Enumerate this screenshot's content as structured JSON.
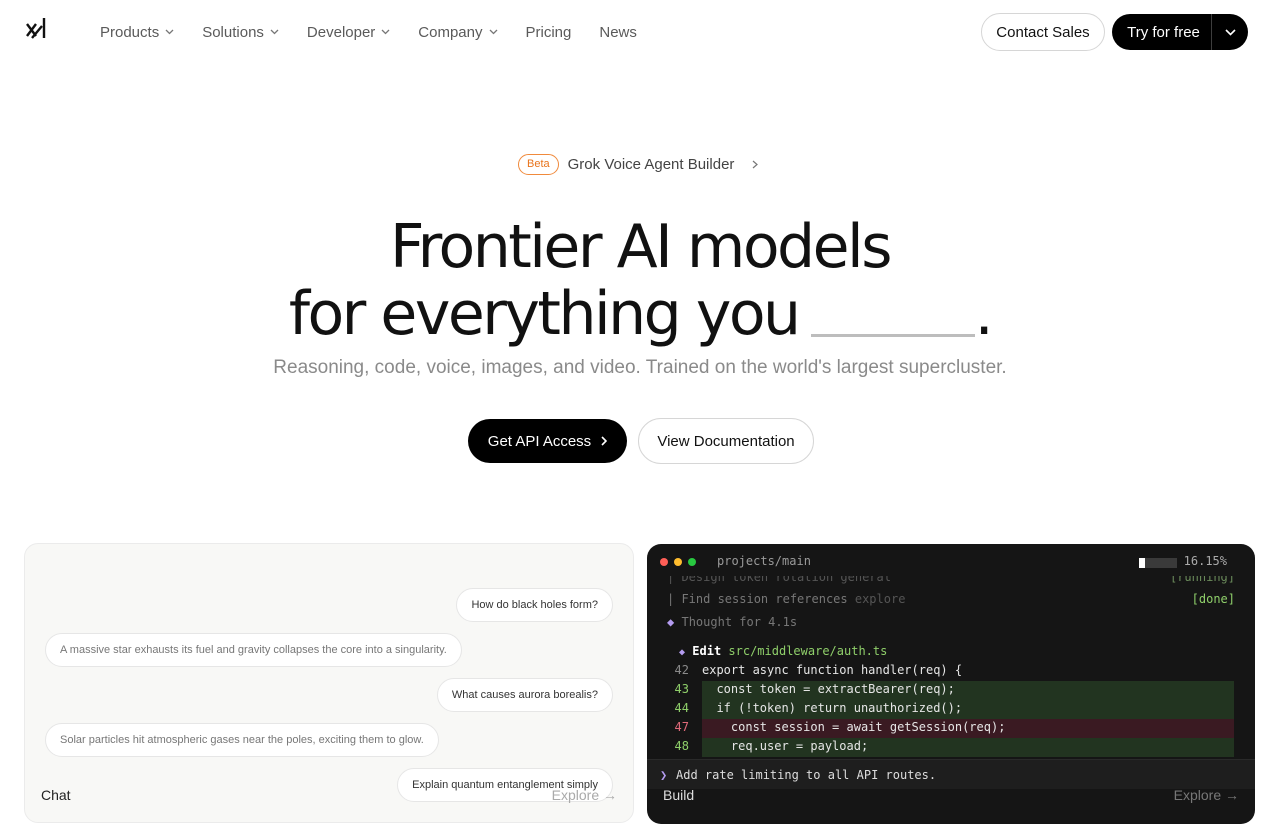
{
  "nav": {
    "logo_alt": "xAI",
    "items": [
      {
        "label": "Products",
        "has_dropdown": true
      },
      {
        "label": "Solutions",
        "has_dropdown": true
      },
      {
        "label": "Developer",
        "has_dropdown": true
      },
      {
        "label": "Company",
        "has_dropdown": true
      },
      {
        "label": "Pricing",
        "has_dropdown": false
      },
      {
        "label": "News",
        "has_dropdown": false
      }
    ],
    "contact_label": "Contact Sales",
    "try_label": "Try for free"
  },
  "announcement": {
    "badge": "Beta",
    "text": "Grok Voice Agent Builder"
  },
  "hero": {
    "line1": "Frontier AI models",
    "line2": "for everything you",
    "line2_end": ".",
    "subtitle": "Reasoning, code, voice, images, and video. Trained on the world's largest supercluster.",
    "primary_button": "Get API Access",
    "secondary_button": "View Documentation"
  },
  "chat_card": {
    "messages": [
      {
        "role": "user",
        "text": "How do black holes form?"
      },
      {
        "role": "assistant",
        "text": "A massive star exhausts its fuel and gravity collapses the core into a singularity."
      },
      {
        "role": "user",
        "text": "What causes aurora borealis?"
      },
      {
        "role": "assistant",
        "text": "Solar particles hit atmospheric gases near the poles, exciting them to glow."
      },
      {
        "role": "user",
        "text": "Explain quantum entanglement simply"
      }
    ],
    "label": "Chat",
    "explore": "Explore →"
  },
  "build_card": {
    "path": "projects/main",
    "progress_percent": 16.15,
    "progress_text": "16.15%",
    "task_top": "| Design token rotation  general",
    "task_top_status": "[running]",
    "task_find": "| Find session references",
    "task_find_tag": "explore",
    "task_find_status": "[done]",
    "thought": "Thought for 4.1s",
    "edit_label": "Edit",
    "edit_file": "src/middleware/auth.ts",
    "code": [
      {
        "num": "42",
        "text": "export async function handler(req) {",
        "kind": "normal"
      },
      {
        "num": "43",
        "text": "  const token = extractBearer(req);",
        "kind": "add"
      },
      {
        "num": "44",
        "text": "  if (!token) return unauthorized();",
        "kind": "add"
      },
      {
        "num": "47",
        "text": "    const session = await getSession(req);",
        "kind": "del"
      },
      {
        "num": "48",
        "text": "    req.user = payload;",
        "kind": "add"
      }
    ],
    "prompt_symbol": "❯",
    "prompt": "Add rate limiting to all API routes.",
    "label": "Build",
    "explore": "Explore →"
  },
  "colors": {
    "accent_orange": "#f08a3c",
    "add_bg": "#223420",
    "del_bg": "#3a1a22"
  }
}
